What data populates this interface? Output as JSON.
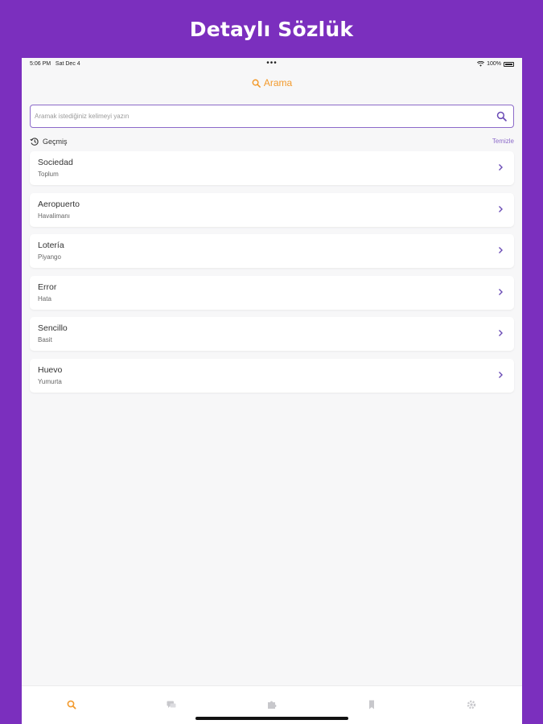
{
  "promo": {
    "title": "Detaylı Sözlük"
  },
  "status_bar": {
    "time": "5:06 PM",
    "date": "Sat Dec 4",
    "battery": "100%"
  },
  "nav": {
    "title": "Arama",
    "icon": "search-icon"
  },
  "search": {
    "placeholder": "Aramak istediğiniz kelimeyi yazın",
    "value": ""
  },
  "history": {
    "label": "Geçmiş",
    "clear_label": "Temizle",
    "items": [
      {
        "word": "Sociedad",
        "meaning": "Toplum"
      },
      {
        "word": "Aeropuerto",
        "meaning": "Havalimanı"
      },
      {
        "word": "Lotería",
        "meaning": "Piyango"
      },
      {
        "word": "Error",
        "meaning": "Hata"
      },
      {
        "word": "Sencillo",
        "meaning": "Basit"
      },
      {
        "word": "Huevo",
        "meaning": "Yumurta"
      }
    ]
  },
  "tab_bar": {
    "tabs": [
      {
        "icon": "search-icon",
        "active": true
      },
      {
        "icon": "chat-icon",
        "active": false
      },
      {
        "icon": "puzzle-icon",
        "active": false
      },
      {
        "icon": "bookmark-icon",
        "active": false
      },
      {
        "icon": "gear-icon",
        "active": false
      }
    ]
  },
  "colors": {
    "brand": "#7b2fbe",
    "accent": "#f39a2c",
    "link": "#8c6ac9",
    "icon_inactive": "#c8c8cc"
  }
}
